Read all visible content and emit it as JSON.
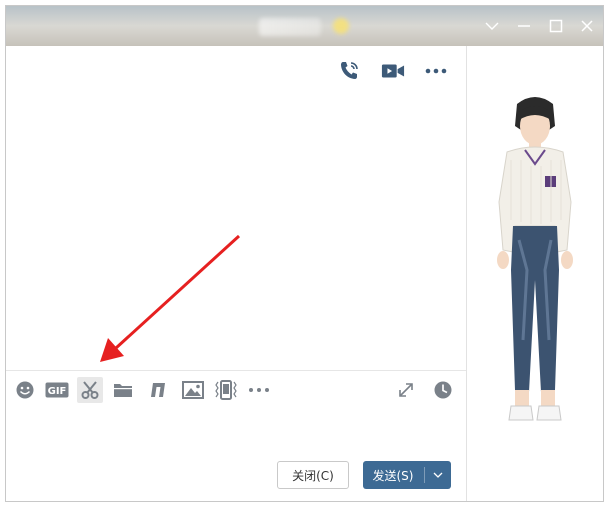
{
  "window": {
    "title_bar_icons": [
      "chevron-down-icon",
      "minimize-icon",
      "maximize-icon",
      "close-icon"
    ]
  },
  "chat_header": {
    "actions": [
      "voice-call-icon",
      "video-call-icon",
      "more-icon"
    ]
  },
  "toolbar": {
    "tools": [
      "emoji-icon",
      "gif-icon",
      "scissors-icon",
      "folder-icon",
      "music-score-icon",
      "image-icon",
      "shake-icon",
      "more-icon"
    ],
    "gif_label": "GIF",
    "right_tools": [
      "expand-icon",
      "clock-icon"
    ]
  },
  "actions": {
    "close_label": "关闭(C)",
    "send_label": "发送(S)"
  },
  "colors": {
    "accent": "#3d6a94",
    "icon_gray": "#7a8189",
    "arrow_red": "#e62020",
    "header_icon": "#3d5a78"
  }
}
